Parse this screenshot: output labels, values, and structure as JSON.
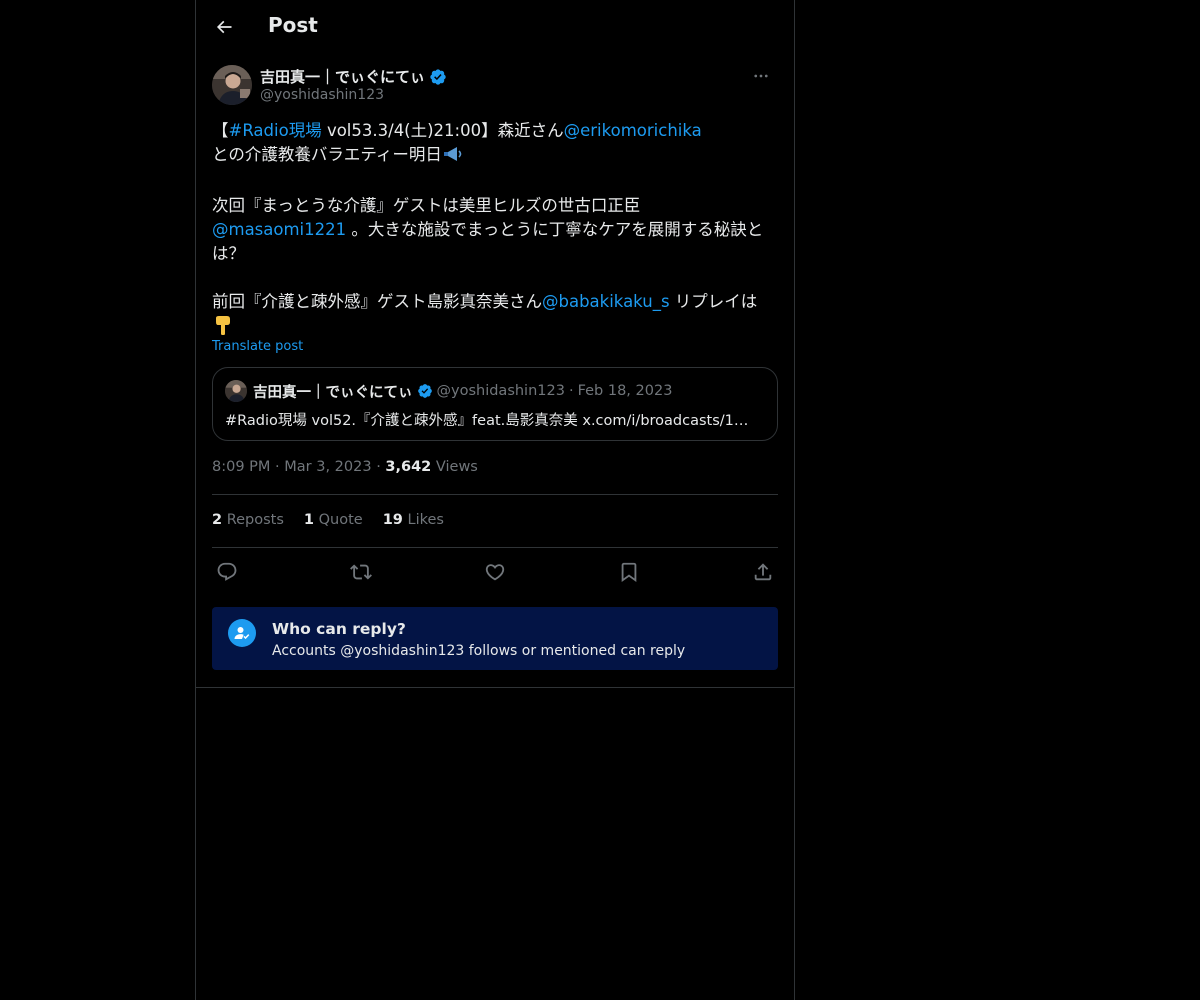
{
  "header": {
    "title": "Post"
  },
  "author": {
    "name": "吉田真一｜でぃぐにてぃ",
    "handle": "@yoshidashin123"
  },
  "post": {
    "lines": [
      [
        {
          "t": "【"
        },
        {
          "t": "#Radio現場",
          "link": true
        },
        {
          "t": " vol53.3/4(土)21:00】森近さん"
        },
        {
          "t": "@erikomorichika",
          "link": true
        }
      ],
      [
        {
          "t": "との介護教養バラエティー明日"
        },
        {
          "t": "megaphone",
          "icon": true
        }
      ],
      [],
      [
        {
          "t": "次回『まっとうな介護』ゲストは美里ヒルズの世古口正臣"
        }
      ],
      [
        {
          "t": "@masaomi1221",
          "link": true
        },
        {
          "t": " 。大きな施設でまっとうに丁寧なケアを展開する秘訣と"
        }
      ],
      [
        {
          "t": "は？"
        }
      ],
      [],
      [
        {
          "t": "前回『介護と疎外感』ゲスト島影真奈美さん"
        },
        {
          "t": "@babakikaku_s",
          "link": true
        },
        {
          "t": " リプレイは"
        }
      ],
      [
        {
          "t": "pointing-down-hand",
          "icon": true
        }
      ]
    ],
    "translate_label": "Translate post"
  },
  "quoted": {
    "name": "吉田真一｜でぃぐにてぃ",
    "handle": "@yoshidashin123",
    "sep": "·",
    "date": "Feb 18, 2023",
    "text": "#Radio現場 vol52.『介護と疎外感』feat.島影真奈美 x.com/i/broadcasts/1…"
  },
  "meta": {
    "time": "8:09 PM",
    "sep": "·",
    "date": "Mar 3, 2023",
    "views_count": "3,642",
    "views_label": " Views"
  },
  "stats": {
    "reposts_count": "2",
    "reposts_label": " Reposts",
    "quotes_count": "1",
    "quotes_label": " Quote",
    "likes_count": "19",
    "likes_label": " Likes"
  },
  "who_can_reply": {
    "title": "Who can reply?",
    "subtitle": "Accounts @yoshidashin123 follows or mentioned can reply"
  },
  "colors": {
    "accent": "#1d9bf0",
    "background": "#000000",
    "border": "#2f3336",
    "muted_text": "#71767b",
    "reply_box_bg": "#031445"
  }
}
